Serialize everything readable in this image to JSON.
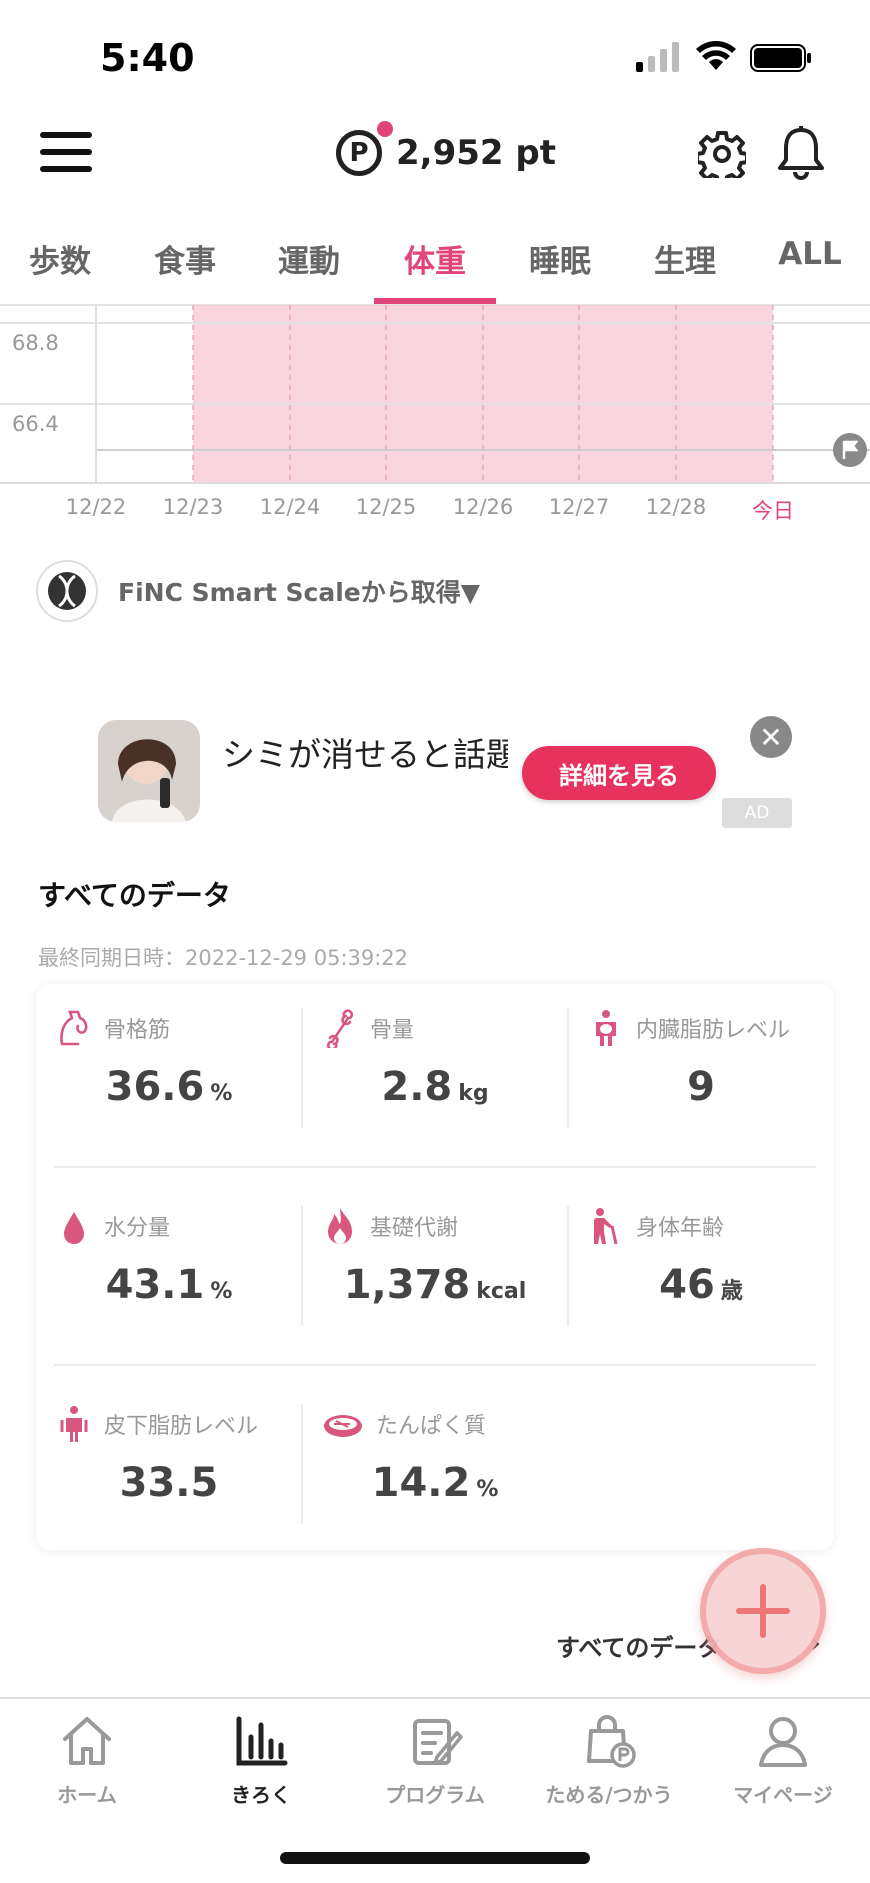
{
  "status_bar": {
    "time": "5:40"
  },
  "header": {
    "points": "2,952 pt",
    "points_icon_letter": "P"
  },
  "tabs": [
    {
      "label": "歩数"
    },
    {
      "label": "食事"
    },
    {
      "label": "運動"
    },
    {
      "label": "体重",
      "active": true
    },
    {
      "label": "睡眠"
    },
    {
      "label": "生理"
    },
    {
      "label": "ALL"
    }
  ],
  "chart_data": {
    "type": "line",
    "y_ticks": [
      "68.8",
      "66.4"
    ],
    "x_labels": [
      "12/22",
      "12/23",
      "12/24",
      "12/25",
      "12/26",
      "12/27",
      "12/28",
      "今日"
    ],
    "highlight_range": [
      "12/23",
      "今日"
    ],
    "highlight_color": "#f7c7d4",
    "today_color": "#e0447a"
  },
  "source": {
    "label": "FiNC Smart Scaleから取得▼"
  },
  "ad": {
    "title": "シミが消せると話題",
    "button": "詳細を見る",
    "badge": "AD"
  },
  "all_data": {
    "title": "すべてのデータ",
    "sync_time": "最終同期日時：2022-12-29 05:39:22",
    "metrics": [
      {
        "label": "骨格筋",
        "value": "36.6",
        "unit": "%",
        "icon": "muscle-icon"
      },
      {
        "label": "骨量",
        "value": "2.8",
        "unit": "kg",
        "icon": "bone-icon"
      },
      {
        "label": "内臓脂肪レベル",
        "value": "9",
        "unit": "",
        "icon": "visceral-fat-icon"
      },
      {
        "label": "水分量",
        "value": "43.1",
        "unit": "%",
        "icon": "water-drop-icon"
      },
      {
        "label": "基礎代謝",
        "value": "1,378",
        "unit": "kcal",
        "icon": "flame-icon"
      },
      {
        "label": "身体年齢",
        "value": "46",
        "unit": "歳",
        "icon": "body-age-icon"
      },
      {
        "label": "皮下脂肪レベル",
        "value": "33.5",
        "unit": "",
        "icon": "subcutaneous-fat-icon"
      },
      {
        "label": "たんぱく質",
        "value": "14.2",
        "unit": "%",
        "icon": "protein-meat-icon"
      }
    ],
    "see_all": "すべてのデータ",
    "see_all_chevron": "›"
  },
  "bottom_nav": [
    {
      "label": "ホーム",
      "icon": "home-icon"
    },
    {
      "label": "きろく",
      "icon": "record-chart-icon",
      "active": true
    },
    {
      "label": "プログラム",
      "icon": "program-icon"
    },
    {
      "label": "ためる/つかう",
      "icon": "points-bag-icon"
    },
    {
      "label": "マイページ",
      "icon": "person-icon"
    }
  ],
  "colors": {
    "accent": "#e0447a",
    "ad_button": "#e8325e",
    "metric_icon": "#d9577f"
  }
}
